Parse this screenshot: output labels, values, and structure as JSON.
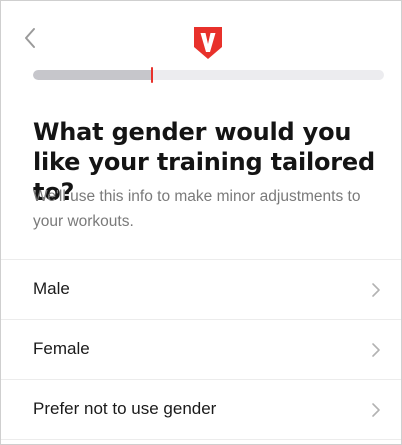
{
  "header": {
    "back_icon": "chevron-left-icon",
    "logo_icon": "brand-v-shield-icon",
    "brand_color": "#e8312b"
  },
  "progress": {
    "fraction": 0.34
  },
  "question": {
    "title": "What gender would you like your training tailored to?",
    "subtitle": "We'll use this info to make minor adjustments to your workouts."
  },
  "options": [
    {
      "label": "Male",
      "icon": "chevron-right-icon"
    },
    {
      "label": "Female",
      "icon": "chevron-right-icon"
    },
    {
      "label": "Prefer not to use gender",
      "icon": "chevron-right-icon"
    }
  ]
}
